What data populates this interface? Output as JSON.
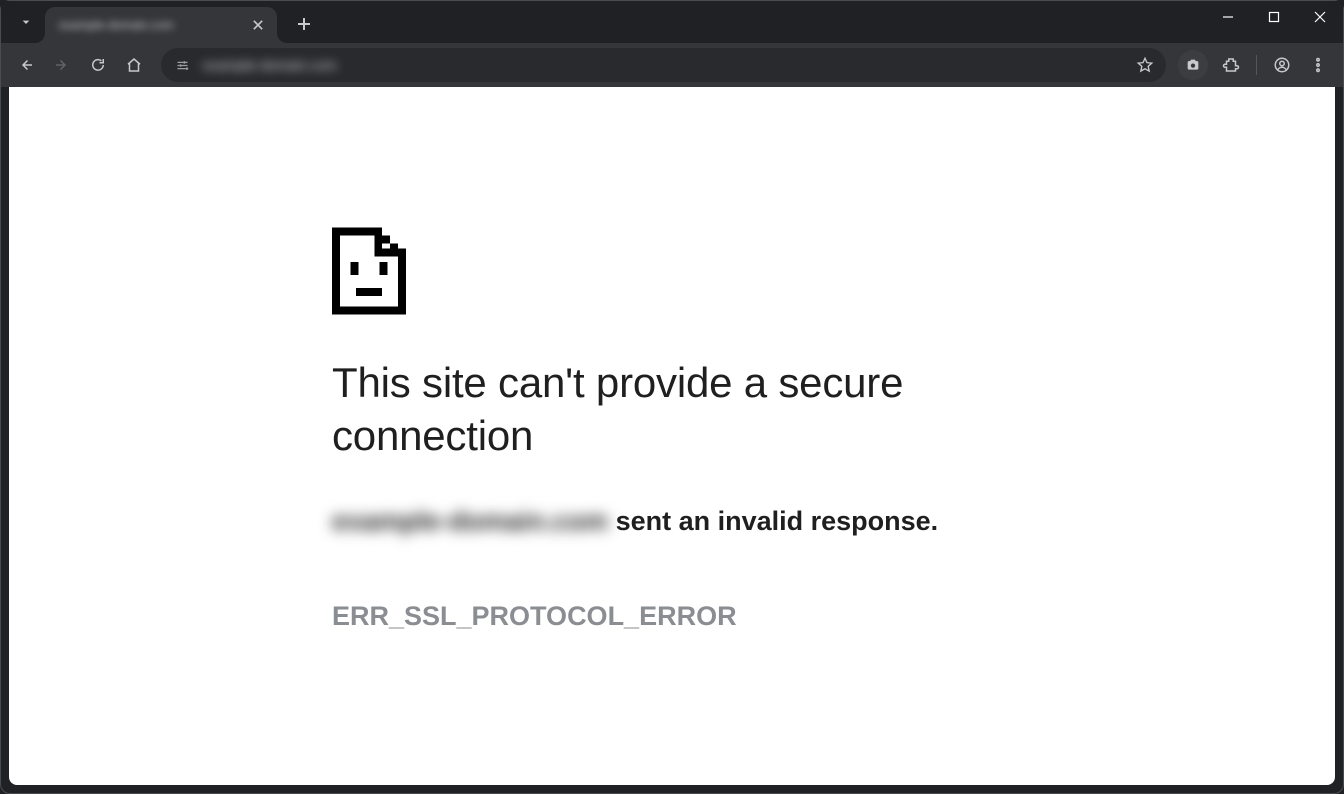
{
  "browser": {
    "tab_title": "example-domain.com",
    "url_display": "example-domain.com"
  },
  "error_page": {
    "heading": "This site can't provide a secure connection",
    "domain_blurred": "example-domain.com",
    "response_suffix": " sent an invalid response.",
    "error_code": "ERR_SSL_PROTOCOL_ERROR"
  }
}
